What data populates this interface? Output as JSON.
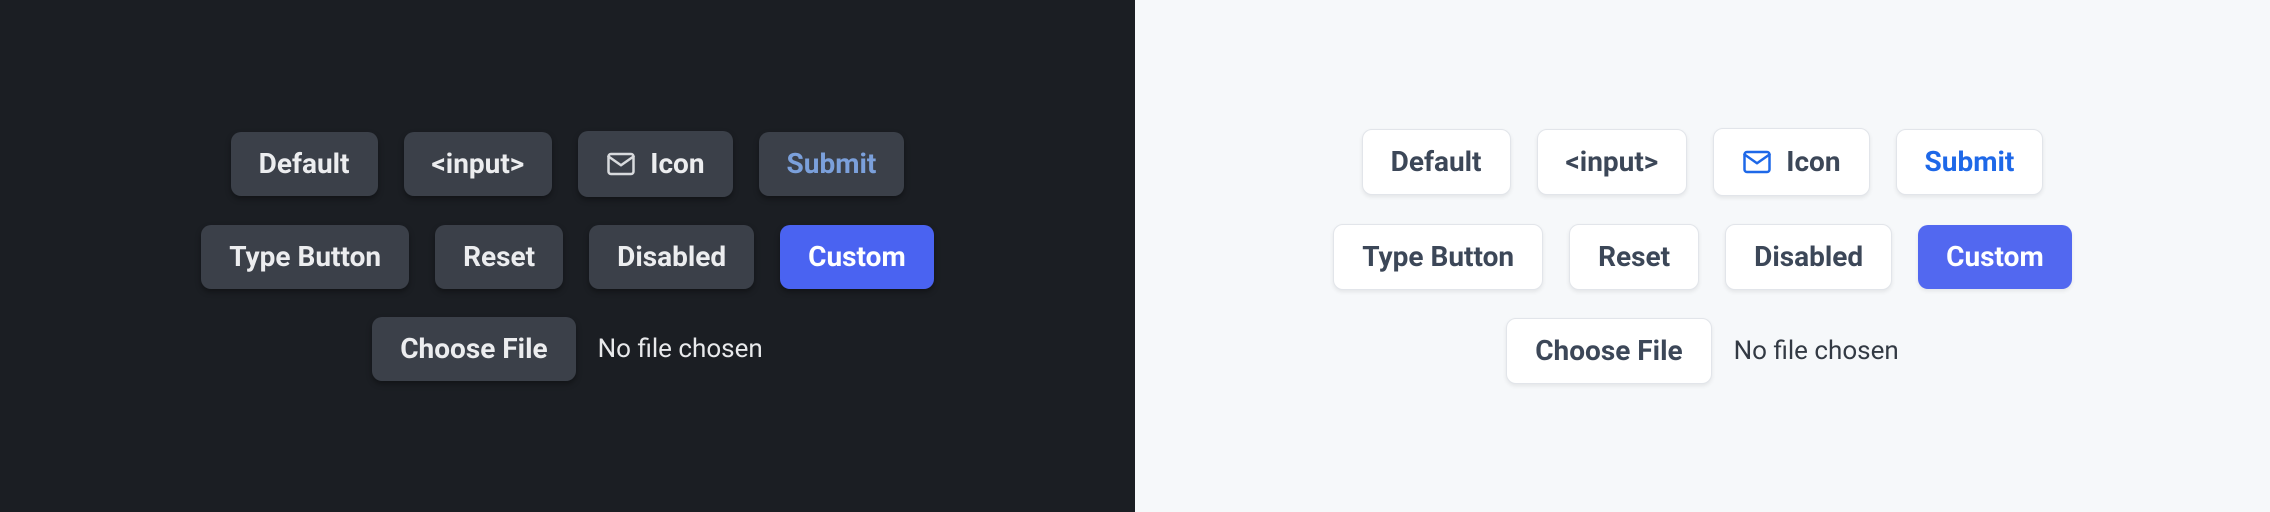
{
  "buttons": {
    "default": "Default",
    "input": "<input>",
    "icon": "Icon",
    "submit": "Submit",
    "type_button": "Type Button",
    "reset": "Reset",
    "disabled": "Disabled",
    "custom": "Custom",
    "choose_file": "Choose File"
  },
  "file": {
    "status": "No file chosen"
  },
  "icon_name": "mail-icon"
}
